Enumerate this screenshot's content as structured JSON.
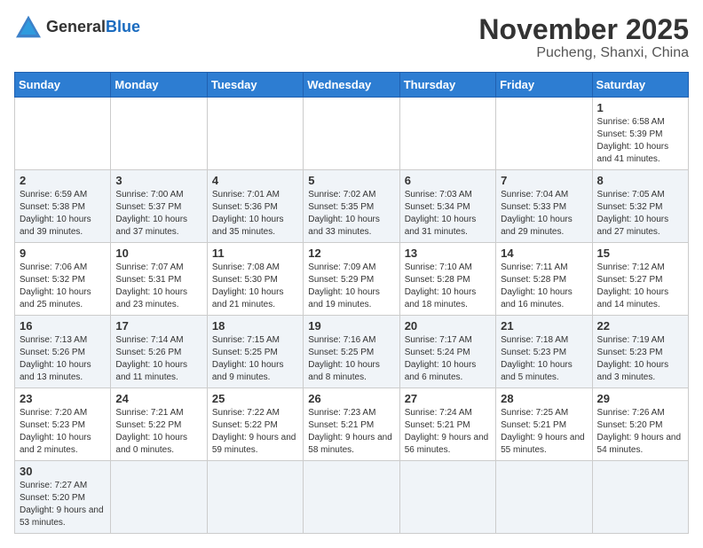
{
  "header": {
    "logo_general": "General",
    "logo_blue": "Blue",
    "month_title": "November 2025",
    "location": "Pucheng, Shanxi, China"
  },
  "weekdays": [
    "Sunday",
    "Monday",
    "Tuesday",
    "Wednesday",
    "Thursday",
    "Friday",
    "Saturday"
  ],
  "weeks": [
    [
      {
        "day": "",
        "info": ""
      },
      {
        "day": "",
        "info": ""
      },
      {
        "day": "",
        "info": ""
      },
      {
        "day": "",
        "info": ""
      },
      {
        "day": "",
        "info": ""
      },
      {
        "day": "",
        "info": ""
      },
      {
        "day": "1",
        "info": "Sunrise: 6:58 AM\nSunset: 5:39 PM\nDaylight: 10 hours and 41 minutes."
      }
    ],
    [
      {
        "day": "2",
        "info": "Sunrise: 6:59 AM\nSunset: 5:38 PM\nDaylight: 10 hours and 39 minutes."
      },
      {
        "day": "3",
        "info": "Sunrise: 7:00 AM\nSunset: 5:37 PM\nDaylight: 10 hours and 37 minutes."
      },
      {
        "day": "4",
        "info": "Sunrise: 7:01 AM\nSunset: 5:36 PM\nDaylight: 10 hours and 35 minutes."
      },
      {
        "day": "5",
        "info": "Sunrise: 7:02 AM\nSunset: 5:35 PM\nDaylight: 10 hours and 33 minutes."
      },
      {
        "day": "6",
        "info": "Sunrise: 7:03 AM\nSunset: 5:34 PM\nDaylight: 10 hours and 31 minutes."
      },
      {
        "day": "7",
        "info": "Sunrise: 7:04 AM\nSunset: 5:33 PM\nDaylight: 10 hours and 29 minutes."
      },
      {
        "day": "8",
        "info": "Sunrise: 7:05 AM\nSunset: 5:32 PM\nDaylight: 10 hours and 27 minutes."
      }
    ],
    [
      {
        "day": "9",
        "info": "Sunrise: 7:06 AM\nSunset: 5:32 PM\nDaylight: 10 hours and 25 minutes."
      },
      {
        "day": "10",
        "info": "Sunrise: 7:07 AM\nSunset: 5:31 PM\nDaylight: 10 hours and 23 minutes."
      },
      {
        "day": "11",
        "info": "Sunrise: 7:08 AM\nSunset: 5:30 PM\nDaylight: 10 hours and 21 minutes."
      },
      {
        "day": "12",
        "info": "Sunrise: 7:09 AM\nSunset: 5:29 PM\nDaylight: 10 hours and 19 minutes."
      },
      {
        "day": "13",
        "info": "Sunrise: 7:10 AM\nSunset: 5:28 PM\nDaylight: 10 hours and 18 minutes."
      },
      {
        "day": "14",
        "info": "Sunrise: 7:11 AM\nSunset: 5:28 PM\nDaylight: 10 hours and 16 minutes."
      },
      {
        "day": "15",
        "info": "Sunrise: 7:12 AM\nSunset: 5:27 PM\nDaylight: 10 hours and 14 minutes."
      }
    ],
    [
      {
        "day": "16",
        "info": "Sunrise: 7:13 AM\nSunset: 5:26 PM\nDaylight: 10 hours and 13 minutes."
      },
      {
        "day": "17",
        "info": "Sunrise: 7:14 AM\nSunset: 5:26 PM\nDaylight: 10 hours and 11 minutes."
      },
      {
        "day": "18",
        "info": "Sunrise: 7:15 AM\nSunset: 5:25 PM\nDaylight: 10 hours and 9 minutes."
      },
      {
        "day": "19",
        "info": "Sunrise: 7:16 AM\nSunset: 5:25 PM\nDaylight: 10 hours and 8 minutes."
      },
      {
        "day": "20",
        "info": "Sunrise: 7:17 AM\nSunset: 5:24 PM\nDaylight: 10 hours and 6 minutes."
      },
      {
        "day": "21",
        "info": "Sunrise: 7:18 AM\nSunset: 5:23 PM\nDaylight: 10 hours and 5 minutes."
      },
      {
        "day": "22",
        "info": "Sunrise: 7:19 AM\nSunset: 5:23 PM\nDaylight: 10 hours and 3 minutes."
      }
    ],
    [
      {
        "day": "23",
        "info": "Sunrise: 7:20 AM\nSunset: 5:23 PM\nDaylight: 10 hours and 2 minutes."
      },
      {
        "day": "24",
        "info": "Sunrise: 7:21 AM\nSunset: 5:22 PM\nDaylight: 10 hours and 0 minutes."
      },
      {
        "day": "25",
        "info": "Sunrise: 7:22 AM\nSunset: 5:22 PM\nDaylight: 9 hours and 59 minutes."
      },
      {
        "day": "26",
        "info": "Sunrise: 7:23 AM\nSunset: 5:21 PM\nDaylight: 9 hours and 58 minutes."
      },
      {
        "day": "27",
        "info": "Sunrise: 7:24 AM\nSunset: 5:21 PM\nDaylight: 9 hours and 56 minutes."
      },
      {
        "day": "28",
        "info": "Sunrise: 7:25 AM\nSunset: 5:21 PM\nDaylight: 9 hours and 55 minutes."
      },
      {
        "day": "29",
        "info": "Sunrise: 7:26 AM\nSunset: 5:20 PM\nDaylight: 9 hours and 54 minutes."
      }
    ],
    [
      {
        "day": "30",
        "info": "Sunrise: 7:27 AM\nSunset: 5:20 PM\nDaylight: 9 hours and 53 minutes."
      },
      {
        "day": "",
        "info": ""
      },
      {
        "day": "",
        "info": ""
      },
      {
        "day": "",
        "info": ""
      },
      {
        "day": "",
        "info": ""
      },
      {
        "day": "",
        "info": ""
      },
      {
        "day": "",
        "info": ""
      }
    ]
  ]
}
